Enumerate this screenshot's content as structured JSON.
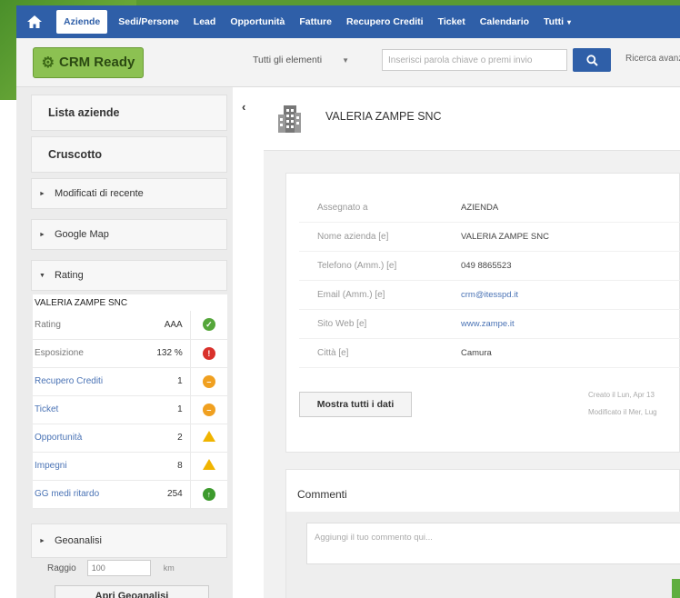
{
  "nav": {
    "items": [
      "Aziende",
      "Sedi/Persone",
      "Lead",
      "Opportunità",
      "Fatture",
      "Recupero Crediti",
      "Ticket",
      "Calendario",
      "Tutti"
    ],
    "active": "Aziende",
    "tutti_caret": "▾"
  },
  "header": {
    "logo": "CRM Ready",
    "search_scope": "Tutti gli elementi",
    "search_placeholder": "Inserisci parola chiave o premi invio",
    "advanced_search": "Ricerca avanzata"
  },
  "sidebar": {
    "lista_aziende": "Lista aziende",
    "cruscotto": "Cruscotto",
    "modificati": "Modificati di recente",
    "google_map": "Google Map",
    "rating": "Rating",
    "rating_company": "VALERIA ZAMPE SNC",
    "rating_rows": [
      {
        "label": "Rating",
        "value": "AAA",
        "status": "ok"
      },
      {
        "label": "Esposizione",
        "value": "132 %",
        "status": "bad"
      },
      {
        "label": "Recupero Crediti",
        "value": "1",
        "status": "warn"
      },
      {
        "label": "Ticket",
        "value": "1",
        "status": "warn"
      },
      {
        "label": "Opportunità",
        "value": "2",
        "status": "triangle"
      },
      {
        "label": "Impegni",
        "value": "8",
        "status": "triangle"
      },
      {
        "label": "GG medi ritardo",
        "value": "254",
        "status": "up"
      }
    ],
    "geoanalisi": "Geoanalisi",
    "raggio_label": "Raggio",
    "raggio_value": "100",
    "raggio_unit": "km",
    "apri_geoanalisi": "Apri Geoanalisi"
  },
  "main": {
    "company_name": "VALERIA ZAMPE SNC",
    "fields": [
      {
        "label": "Assegnato a",
        "value": "AZIENDA",
        "link": false
      },
      {
        "label": "Nome azienda [e]",
        "value": "VALERIA ZAMPE SNC",
        "link": false
      },
      {
        "label": "Telefono (Amm.) [e]",
        "value": "049 8865523",
        "link": false
      },
      {
        "label": "Email (Amm.) [e]",
        "value": "crm@itesspd.it",
        "link": true
      },
      {
        "label": "Sito Web [e]",
        "value": "www.zampe.it",
        "link": true
      },
      {
        "label": "Città [e]",
        "value": "Camura",
        "link": false
      }
    ],
    "show_all": "Mostra tutti i dati",
    "created": "Creato il Lun, Apr 13",
    "modified": "Modificato il Mer, Lug",
    "comments_title": "Commenti",
    "comment_placeholder": "Aggiungi il tuo commento qui..."
  },
  "colors": {
    "nav_blue": "#2f5fa8",
    "logo_green": "#8cc152",
    "ok": "#55a63a",
    "bad": "#d9312b",
    "warn": "#f0a020"
  }
}
